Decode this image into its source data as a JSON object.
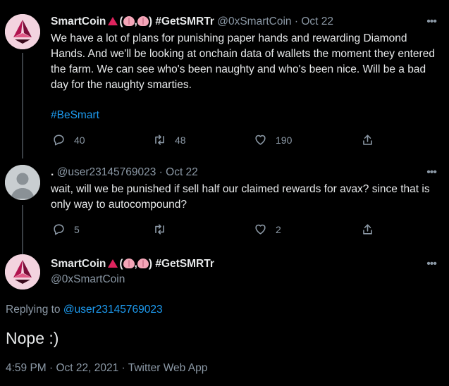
{
  "tweet1": {
    "display_name": "SmartCoin",
    "name_suffix": "(",
    "name_comma": ",",
    "name_close": ")",
    "name_tag": "#GetSMRTr",
    "handle": "@0xSmartCoin",
    "separator": "·",
    "date": "Oct 22",
    "text": "We have a lot of plans for punishing paper hands and rewarding Diamond Hands. And we'll be looking at onchain data of wallets the moment they entered the farm. We can see who's been naughty and who's been nice. Will be a bad day for the naughty smarties.",
    "hashtag": "#BeSmart",
    "replies": "40",
    "retweets": "48",
    "likes": "190"
  },
  "tweet2": {
    "display_name": ".",
    "handle": "@user23145769023",
    "separator": "·",
    "date": "Oct 22",
    "text": "wait, will we be punished if sell half our claimed rewards for avax? since that is only way to autocompound?",
    "replies": "5",
    "likes": "2"
  },
  "tweet3": {
    "display_name": "SmartCoin",
    "name_suffix": "(",
    "name_comma": ",",
    "name_close": ")",
    "name_tag": "#GetSMRTr",
    "handle": "@0xSmartCoin",
    "replying_prefix": "Replying to",
    "replying_to": "@user23145769023",
    "text": "Nope :)",
    "timestamp": "4:59 PM · Oct 22, 2021 · Twitter Web App"
  },
  "icons": {
    "more": "more-icon",
    "reply": "reply-icon",
    "retweet": "retweet-icon",
    "like": "like-icon",
    "share": "share-icon"
  },
  "colors": {
    "background": "#000000",
    "text": "#e7e9ea",
    "muted": "#8b98a5",
    "link": "#1d9bf0",
    "triangle": "#e0245e"
  }
}
